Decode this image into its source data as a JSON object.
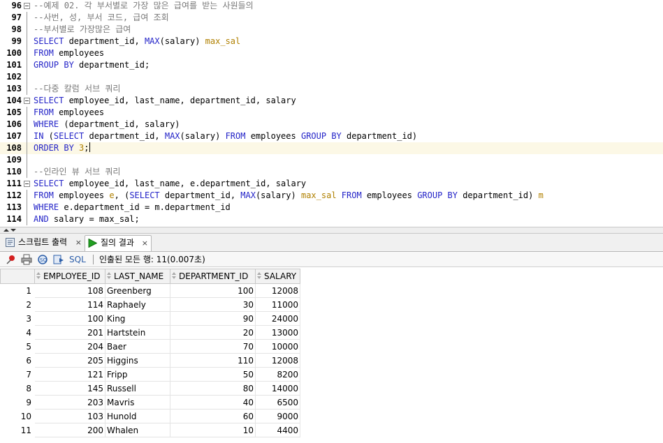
{
  "editor": {
    "lines": [
      {
        "num": "96",
        "fold": true,
        "segments": [
          {
            "t": "--예제 02. 각 부서별로 가장 많은 급여를 받는 사원들의",
            "c": "cm"
          }
        ]
      },
      {
        "num": "97",
        "segments": [
          {
            "t": "--사번, 성, 부서 코드, 급여 조회",
            "c": "cm"
          }
        ]
      },
      {
        "num": "98",
        "segments": [
          {
            "t": "--부서별로 가장많은 급여",
            "c": "cm"
          }
        ]
      },
      {
        "num": "99",
        "segments": [
          {
            "t": "SELECT",
            "c": "kw"
          },
          {
            "t": " department_id, "
          },
          {
            "t": "MAX",
            "c": "fn"
          },
          {
            "t": "(salary) "
          },
          {
            "t": "max_sal",
            "c": "al"
          }
        ]
      },
      {
        "num": "100",
        "segments": [
          {
            "t": "FROM",
            "c": "kw"
          },
          {
            "t": " employees"
          }
        ]
      },
      {
        "num": "101",
        "segments": [
          {
            "t": "GROUP BY",
            "c": "kw"
          },
          {
            "t": " department_id;"
          }
        ]
      },
      {
        "num": "102",
        "segments": []
      },
      {
        "num": "103",
        "segments": [
          {
            "t": "--다중 칼럼 서브 쿼리",
            "c": "cm"
          }
        ]
      },
      {
        "num": "104",
        "fold": true,
        "segments": [
          {
            "t": "SELECT",
            "c": "kw"
          },
          {
            "t": " employee_id, last_name, department_id, salary"
          }
        ]
      },
      {
        "num": "105",
        "segments": [
          {
            "t": "FROM",
            "c": "kw"
          },
          {
            "t": " employees"
          }
        ]
      },
      {
        "num": "106",
        "segments": [
          {
            "t": "WHERE",
            "c": "kw"
          },
          {
            "t": " (department_id, salary)"
          }
        ]
      },
      {
        "num": "107",
        "segments": [
          {
            "t": "IN",
            "c": "kw"
          },
          {
            "t": " ("
          },
          {
            "t": "SELECT",
            "c": "kw"
          },
          {
            "t": " department_id, "
          },
          {
            "t": "MAX",
            "c": "fn"
          },
          {
            "t": "(salary) "
          },
          {
            "t": "FROM",
            "c": "kw"
          },
          {
            "t": " employees "
          },
          {
            "t": "GROUP BY",
            "c": "kw"
          },
          {
            "t": " department_id)"
          }
        ]
      },
      {
        "num": "108",
        "current": true,
        "caret": true,
        "segments": [
          {
            "t": "ORDER BY",
            "c": "kw"
          },
          {
            "t": " "
          },
          {
            "t": "3",
            "c": "al"
          },
          {
            "t": ";"
          }
        ]
      },
      {
        "num": "109",
        "segments": []
      },
      {
        "num": "110",
        "segments": [
          {
            "t": "--인라인 뷰 서브 쿼리",
            "c": "cm"
          }
        ]
      },
      {
        "num": "111",
        "fold": true,
        "segments": [
          {
            "t": "SELECT",
            "c": "kw"
          },
          {
            "t": " employee_id, last_name, e.department_id, salary"
          }
        ]
      },
      {
        "num": "112",
        "segments": [
          {
            "t": "FROM",
            "c": "kw"
          },
          {
            "t": " employees "
          },
          {
            "t": "e",
            "c": "al"
          },
          {
            "t": ", ("
          },
          {
            "t": "SELECT",
            "c": "kw"
          },
          {
            "t": " department_id, "
          },
          {
            "t": "MAX",
            "c": "fn"
          },
          {
            "t": "(salary) "
          },
          {
            "t": "max_sal",
            "c": "al"
          },
          {
            "t": " "
          },
          {
            "t": "FROM",
            "c": "kw"
          },
          {
            "t": " employees "
          },
          {
            "t": "GROUP BY",
            "c": "kw"
          },
          {
            "t": " department_id) "
          },
          {
            "t": "m",
            "c": "al"
          }
        ]
      },
      {
        "num": "113",
        "segments": [
          {
            "t": "WHERE",
            "c": "kw"
          },
          {
            "t": " e.department_id = m.department_id"
          }
        ]
      },
      {
        "num": "114",
        "segments": [
          {
            "t": "AND",
            "c": "kw"
          },
          {
            "t": " salary = max_sal;"
          }
        ]
      }
    ]
  },
  "tabs": {
    "script_output": "스크립트 출력",
    "query_result": "질의 결과",
    "close_glyph": "×"
  },
  "toolbar": {
    "sql_label": "SQL",
    "status": "인출된 모든 행: 11(0.007초)"
  },
  "grid": {
    "columns": [
      "EMPLOYEE_ID",
      "LAST_NAME",
      "DEPARTMENT_ID",
      "SALARY"
    ],
    "rows": [
      [
        "1",
        "108",
        "Greenberg",
        "100",
        "12008"
      ],
      [
        "2",
        "114",
        "Raphaely",
        "30",
        "11000"
      ],
      [
        "3",
        "100",
        "King",
        "90",
        "24000"
      ],
      [
        "4",
        "201",
        "Hartstein",
        "20",
        "13000"
      ],
      [
        "5",
        "204",
        "Baer",
        "70",
        "10000"
      ],
      [
        "6",
        "205",
        "Higgins",
        "110",
        "12008"
      ],
      [
        "7",
        "121",
        "Fripp",
        "50",
        "8200"
      ],
      [
        "8",
        "145",
        "Russell",
        "80",
        "14000"
      ],
      [
        "9",
        "203",
        "Mavris",
        "40",
        "6500"
      ],
      [
        "10",
        "103",
        "Hunold",
        "60",
        "9000"
      ],
      [
        "11",
        "200",
        "Whalen",
        "10",
        "4400"
      ]
    ]
  },
  "colors": {
    "keyword": "#2424c8",
    "comment": "#777777",
    "alias": "#b08000",
    "current_line": "#fcf8e6"
  }
}
